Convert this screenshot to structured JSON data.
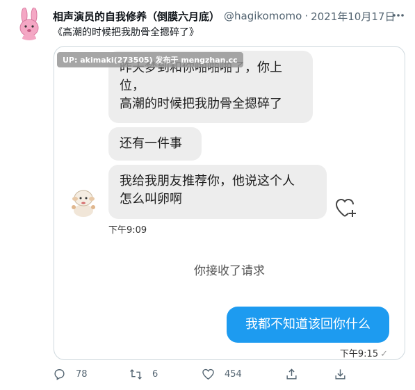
{
  "tweet": {
    "author": "相声演员的自我修养（倒膜六月底）",
    "handle": "@hagikomomo",
    "separator": "·",
    "date": "2021年10月17日",
    "more_icon": "more-horizontal-icon",
    "text": "《高潮的时候把我肋骨全摁碎了》"
  },
  "media": {
    "watermark": "UP: akimaki(273505) 发布于 mengzhan.cc",
    "messages_in": [
      {
        "lines": [
          "昨天梦到和你啪啪啪了，你上",
          "位，",
          "高潮的时候把我肋骨全摁碎了"
        ]
      },
      {
        "lines": [
          "还有一件事"
        ]
      },
      {
        "lines": [
          "我给我朋友推荐你，他说这个人",
          "怎么叫卵啊"
        ]
      }
    ],
    "time_in": "下午9:09",
    "system_text": "你接收了请求",
    "message_out": "我都不知道该回你什么",
    "time_out": "下午9:15",
    "read_check": "✓",
    "colors": {
      "out_bubble": "#1d9bf0",
      "in_bubble": "#ededed"
    }
  },
  "actions": {
    "reply_count": "78",
    "retweet_count": "6",
    "like_count": "454"
  }
}
